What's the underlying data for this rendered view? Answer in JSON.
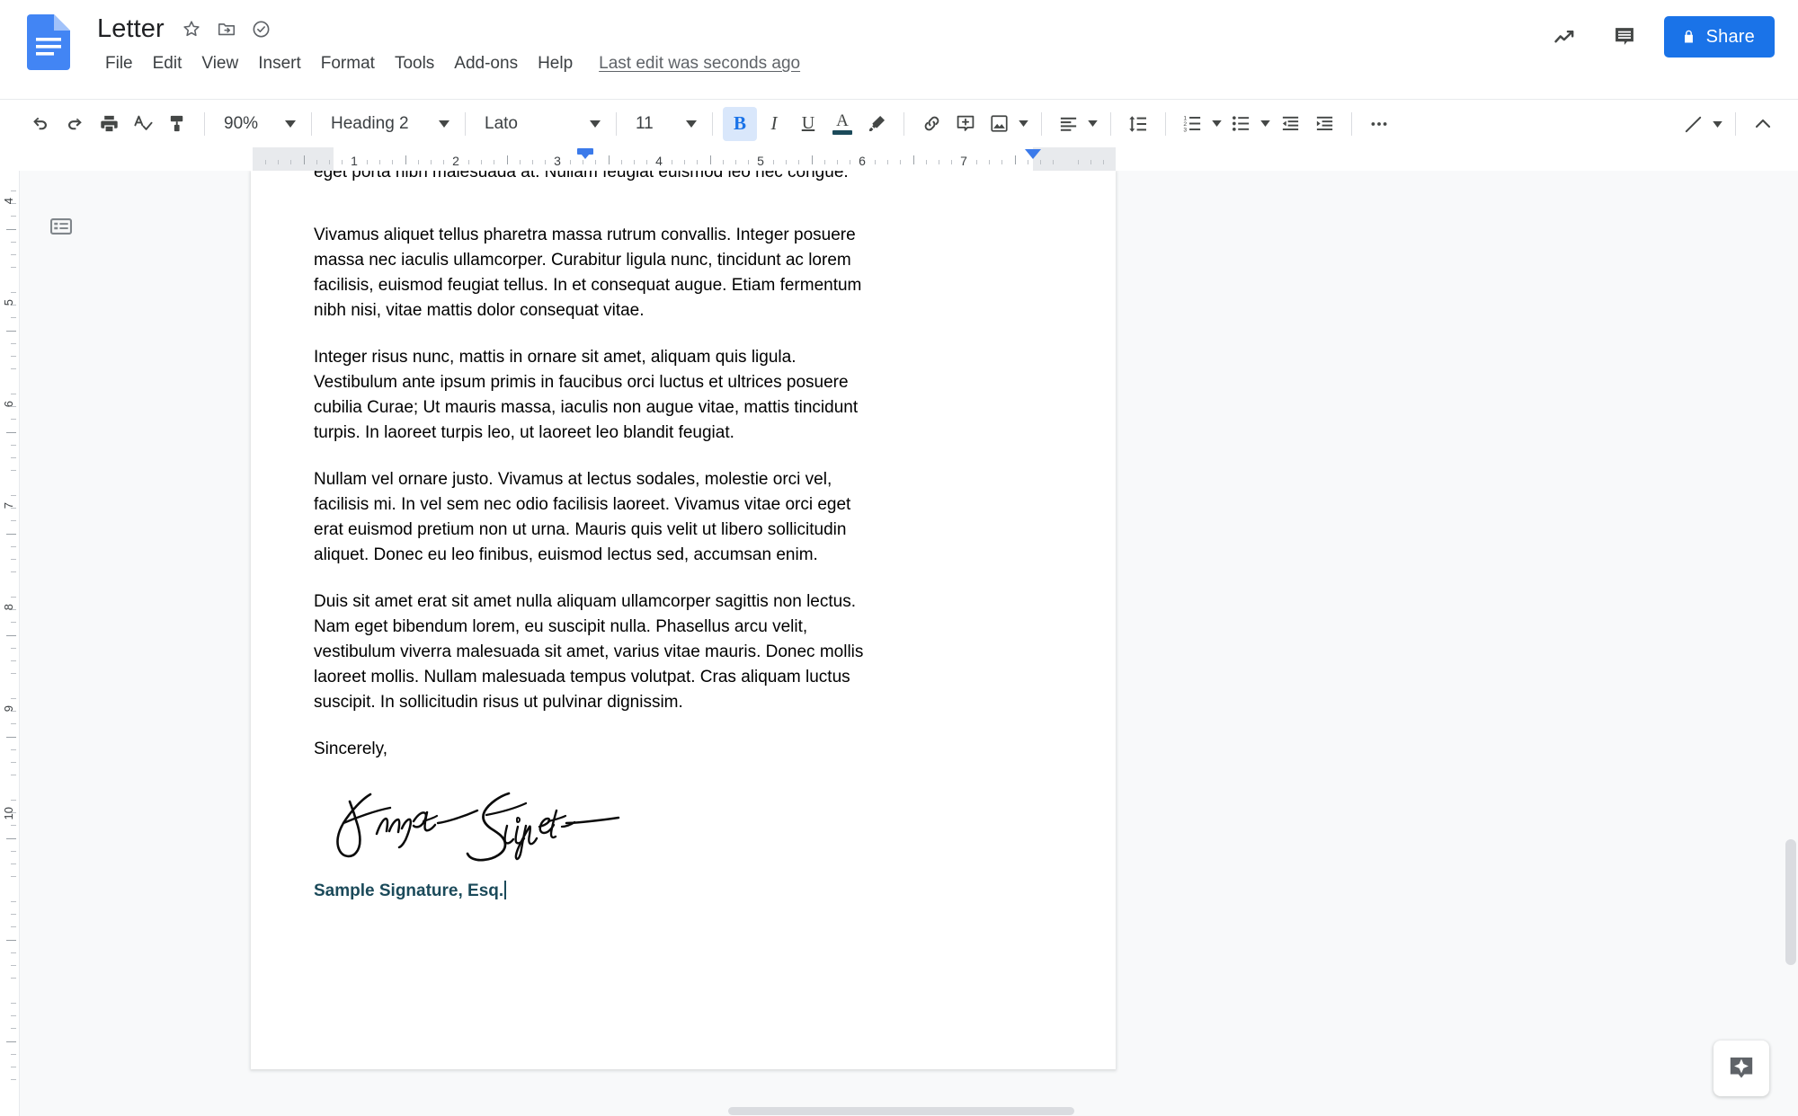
{
  "app": {
    "doc_title": "Letter",
    "logo": "google-docs-logo",
    "title_icons": [
      "star-icon",
      "move-to-folder-icon",
      "cloud-saved-icon"
    ],
    "last_edit": "Last edit was seconds ago"
  },
  "menubar": {
    "items": [
      "File",
      "Edit",
      "View",
      "Insert",
      "Format",
      "Tools",
      "Add-ons",
      "Help"
    ]
  },
  "header_actions": {
    "activity_icon": "activity-trend-icon",
    "comments_icon": "comment-history-icon",
    "share_label": "Share",
    "share_icon": "lock-icon",
    "share_color": "#1a73e8"
  },
  "toolbar": {
    "undo": "undo-icon",
    "redo": "redo-icon",
    "print": "print-icon",
    "spellcheck": "spellcheck-icon",
    "paint_format": "paint-format-icon",
    "zoom_value": "90%",
    "style_value": "Heading 2",
    "font_value": "Lato",
    "size_value": "11",
    "bold_label": "B",
    "bold_active": true,
    "italic_label": "I",
    "underline_label": "U",
    "text_color_label": "A",
    "text_color_swatch": "#1b4a5a",
    "highlight": "highlight-icon",
    "link": "insert-link-icon",
    "comment": "add-comment-icon",
    "image": "insert-image-icon",
    "align": "align-left-icon",
    "line_spacing": "line-spacing-icon",
    "numbered_list": "numbered-list-icon",
    "bulleted_list": "bulleted-list-icon",
    "decrease_indent": "decrease-indent-icon",
    "increase_indent": "increase-indent-icon",
    "more": "more-options-icon",
    "edit_mode": "edit-mode-pencil-icon",
    "collapse": "collapse-toolbar-icon"
  },
  "ruler": {
    "horizontal_numbers": [
      "1",
      "2",
      "3",
      "4",
      "5",
      "6",
      "7"
    ],
    "vertical_numbers": [
      "4",
      "5",
      "6",
      "7",
      "8",
      "9",
      "10"
    ],
    "left_indent_position": "2.5",
    "right_indent_position": "7"
  },
  "sidebar": {
    "outline_icon": "document-outline-icon"
  },
  "document": {
    "paragraphs": [
      "eget porta nibh malesuada at. Nullam feugiat euismod leo nec congue.",
      "Vivamus aliquet tellus pharetra massa rutrum convallis. Integer posuere massa nec iaculis ullamcorper. Curabitur ligula nunc, tincidunt ac lorem facilisis, euismod feugiat tellus. In et consequat augue. Etiam fermentum nibh nisi, vitae mattis dolor consequat vitae.",
      "Integer risus nunc, mattis in ornare sit amet, aliquam quis ligula. Vestibulum ante ipsum primis in faucibus orci luctus et ultrices posuere cubilia Curae; Ut mauris massa, iaculis non augue vitae, mattis tincidunt turpis. In laoreet turpis leo, ut laoreet leo blandit feugiat.",
      "Nullam vel ornare justo. Vivamus at lectus sodales, molestie orci vel, facilisis mi. In vel sem nec odio facilisis laoreet. Vivamus vitae orci eget erat euismod pretium non ut urna. Mauris quis velit ut libero sollicitudin aliquet. Donec eu leo finibus, euismod lectus sed, accumsan enim.",
      "Duis sit amet erat sit amet nulla aliquam ullamcorper sagittis non lectus. Nam eget bibendum lorem, eu suscipit nulla. Phasellus arcu velit, vestibulum viverra malesuada sit amet, varius vitae mauris. Donec mollis laoreet mollis. Nullam malesuada tempus volutpat. Cras aliquam luctus suscipit. In sollicitudin risus ut pulvinar dignissim.",
      "Sincerely,"
    ],
    "signature_image": "handwritten-signature",
    "signature_caption": "Sample Signature, Esq.",
    "caption_color": "#1b4a5a"
  },
  "explore": {
    "icon": "explore-sparkle-icon"
  }
}
